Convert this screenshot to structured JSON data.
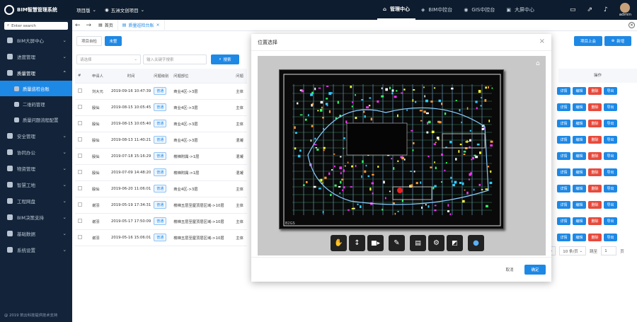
{
  "header": {
    "app_title": "BIM智慧管理系统",
    "edition": "项目版",
    "project": "五洲文创项目",
    "nav": [
      {
        "label": "管理中心",
        "active": true
      },
      {
        "label": "BIM中控台"
      },
      {
        "label": "GIS中控台"
      },
      {
        "label": "大屏中心"
      }
    ],
    "user": "admin"
  },
  "sidebar": {
    "search_placeholder": "Enter search",
    "items": [
      {
        "label": "BIM大屏中心",
        "icon": "cube-icon"
      },
      {
        "label": "进度管理",
        "icon": "grid-icon"
      },
      {
        "label": "质量管理",
        "icon": "shield-icon",
        "open": true,
        "children": [
          {
            "label": "质量巡检台账",
            "active": true
          },
          {
            "label": "二维码管理"
          },
          {
            "label": "质量问题流程配置"
          }
        ]
      },
      {
        "label": "安全管理",
        "icon": "flag-icon"
      },
      {
        "label": "协同办公",
        "icon": "share-icon"
      },
      {
        "label": "物资管理",
        "icon": "box-icon"
      },
      {
        "label": "智慧工地",
        "icon": "site-icon"
      },
      {
        "label": "工程网盘",
        "icon": "folder-icon"
      },
      {
        "label": "BIM决策支持",
        "icon": "support-icon"
      },
      {
        "label": "基础数据",
        "icon": "data-icon"
      },
      {
        "label": "系统设置",
        "icon": "gear-icon"
      }
    ],
    "footer": "@ 2019 筑云科技提供技术支持"
  },
  "tabs": {
    "home": "首页",
    "active": "质量巡检台账"
  },
  "toolbar": {
    "project_inspect": "项目自检",
    "unfinished": "未整",
    "select_placeholder": "请选择",
    "keyword_placeholder": "输入关键字搜索",
    "search": "搜索",
    "upload": "项目上会",
    "add": "新增"
  },
  "table": {
    "columns": [
      "#",
      "申请人",
      "时间",
      "问题级别",
      "问题部位",
      "问题"
    ],
    "level_tag": "普通",
    "rows": [
      [
        "刘大元",
        "2019-09-16 10:47:39",
        "商业4区->3层",
        "主体"
      ],
      [
        "殷仙",
        "2019-08-15 10:05:45",
        "商业4区->3层",
        "主体"
      ],
      [
        "殷仙",
        "2019-08-15 10:05:40",
        "商业4区->3层",
        "主体"
      ],
      [
        "殷仙",
        "2019-08-13 11:40:21",
        "商业4区->3层",
        "混凝"
      ],
      [
        "殷仙",
        "2019-07-18 15:16:29",
        "楼梯附属->1层",
        "混凝"
      ],
      [
        "殷仙",
        "2019-07-09 14:48:20",
        "楼梯附属->1层",
        "混凝"
      ],
      [
        "殷仙",
        "2019-06-20 11:06:01",
        "商业4区->3层",
        "主体"
      ],
      [
        "谢羽",
        "2019-05-19 17:34:31",
        "楼梯五层至屋顶层区域->10层",
        "主体"
      ],
      [
        "谢羽",
        "2019-05-17 17:50:09",
        "楼梯五层至屋顶层区域->10层",
        "主体"
      ],
      [
        "谢羽",
        "2019-05-16 15:06:01",
        "楼梯五层至屋顶层区域->10层",
        "主体"
      ]
    ],
    "ops_header": "操作",
    "ops": [
      "详情",
      "编辑",
      "删除",
      "导出"
    ]
  },
  "pager": {
    "size": "10 条/页",
    "goto": "跳至",
    "page": "1",
    "unit": "页"
  },
  "modal": {
    "title": "位置选择",
    "cancel": "取消",
    "confirm": "确定",
    "cad_label": "B2GS"
  },
  "colors": {
    "accent": "#1e88e5",
    "danger": "#e64a3c",
    "sidebar": "#13243a",
    "header": "#0d1c2e"
  }
}
